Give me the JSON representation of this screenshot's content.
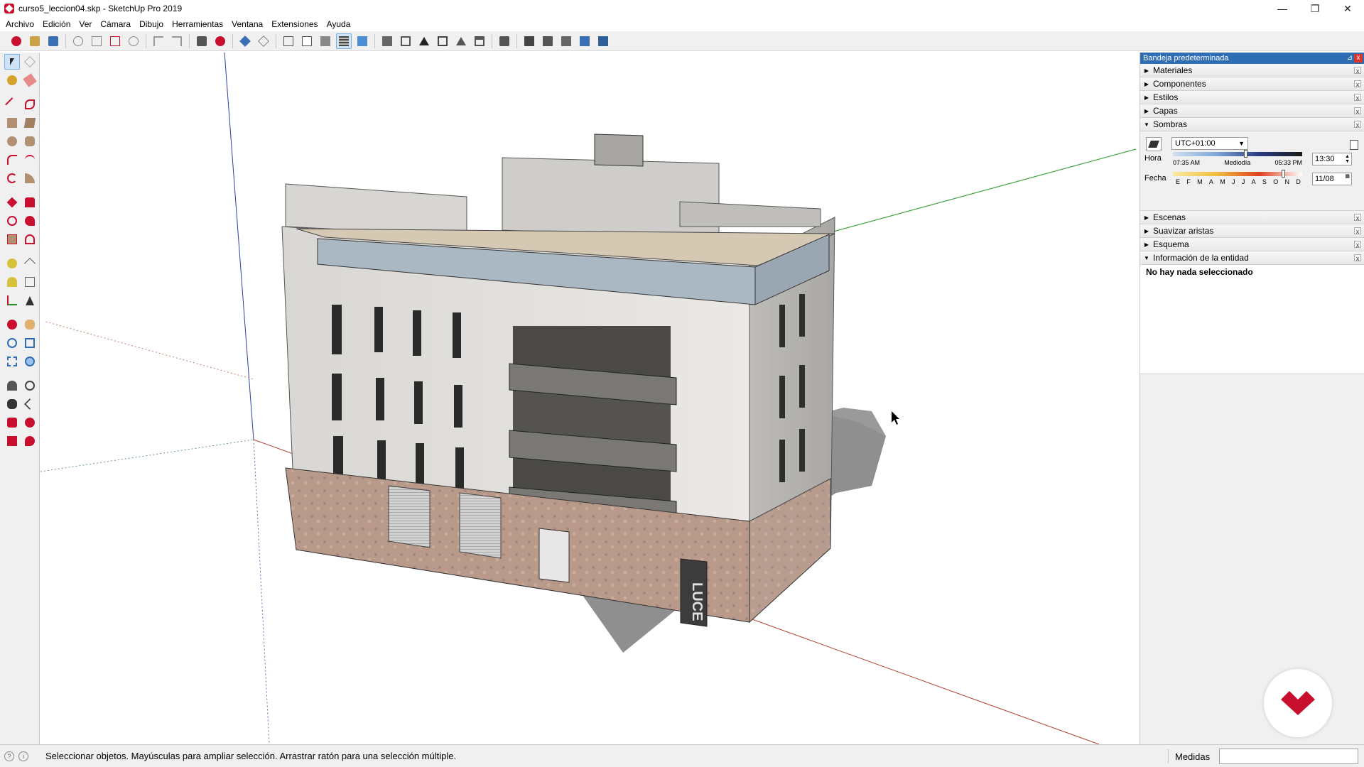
{
  "window": {
    "title": "curso5_leccion04.skp - SketchUp Pro 2019",
    "minimize": "—",
    "restore": "❐",
    "close": "✕"
  },
  "menu": [
    "Archivo",
    "Edición",
    "Ver",
    "Cámara",
    "Dibujo",
    "Herramientas",
    "Ventana",
    "Extensiones",
    "Ayuda"
  ],
  "tray": {
    "title": "Bandeja predeterminada",
    "panels": {
      "materiales": "Materiales",
      "componentes": "Componentes",
      "estilos": "Estilos",
      "capas": "Capas",
      "sombras": "Sombras",
      "escenas": "Escenas",
      "suavizar": "Suavizar aristas",
      "esquema": "Esquema",
      "entidad": "Información de la entidad"
    },
    "shadows": {
      "timezone": "UTC+01:00",
      "hora_label": "Hora",
      "fecha_label": "Fecha",
      "sunrise": "07:35 AM",
      "midday": "Mediodía",
      "sunset": "05:33 PM",
      "time_value": "13:30",
      "date_value": "11/08",
      "months": [
        "E",
        "F",
        "M",
        "A",
        "M",
        "J",
        "J",
        "A",
        "S",
        "O",
        "N",
        "D"
      ],
      "time_fraction": 0.56,
      "date_fraction": 0.85
    },
    "entity_info": "No hay nada seleccionado"
  },
  "status": {
    "message": "Seleccionar objetos. Mayúsculas para ampliar selección. Arrastrar ratón para una selección múltiple.",
    "measure_label": "Medidas",
    "measure_value": ""
  },
  "building_sign": "LUCE",
  "colors": {
    "accent": "#2e6db4",
    "brand_red": "#c8102e",
    "facade": "#e6e4e0",
    "stone": "#b8998a"
  }
}
